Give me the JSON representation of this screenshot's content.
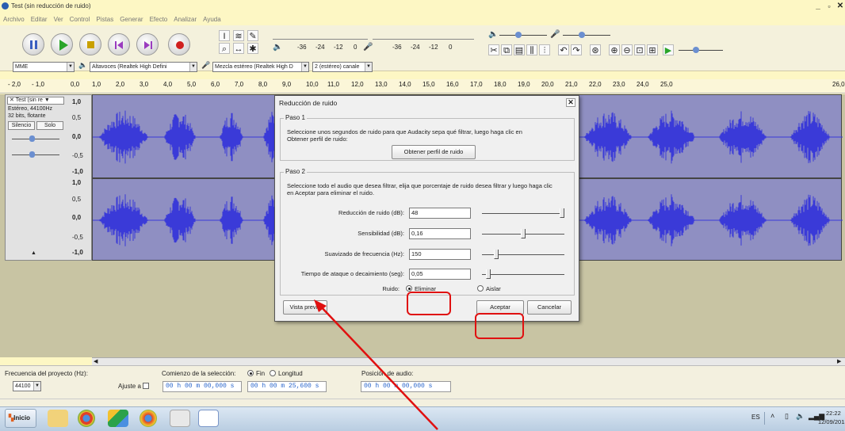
{
  "window": {
    "title": "Test (sin reducción de ruido)"
  },
  "menu": [
    "Archivo",
    "Editar",
    "Ver",
    "Control",
    "Pistas",
    "Generar",
    "Efecto",
    "Analizar",
    "Ayuda"
  ],
  "meters": {
    "play_ticks": [
      "-36",
      "-24",
      "-12",
      "0"
    ],
    "rec_ticks": [
      "-36",
      "-24",
      "-12",
      "0"
    ]
  },
  "devices": {
    "host": "MME",
    "output": "Altavoces (Realtek High Defini",
    "input": "Mezcla estéreo (Realtek High D",
    "channels": "2 (estéreo) canale"
  },
  "ruler": [
    "- 2,0",
    "- 1,0",
    "0,0",
    "1,0",
    "2,0",
    "3,0",
    "4,0",
    "5,0",
    "6,0",
    "7,0",
    "8,0",
    "9,0",
    "10,0",
    "11,0",
    "12,0",
    "13,0",
    "14,0",
    "15,0",
    "16,0",
    "17,0",
    "18,0",
    "19,0",
    "20,0",
    "21,0",
    "22,0",
    "23,0",
    "24,0",
    "25,0",
    "26,0"
  ],
  "track": {
    "name": "Test (sin re",
    "info1": "Estéreo, 44100Hz",
    "info2": "32 bits, flotante",
    "mute": "Silencio",
    "solo": "Solo",
    "scale_top": [
      "1,0",
      "0,5",
      "0,0",
      "-0,5",
      "-1,0"
    ],
    "scale_bottom": [
      "1,0",
      "0,5",
      "0,0",
      "-0,5",
      "-1,0"
    ]
  },
  "dialog": {
    "title": "Reducción de ruido",
    "step1_label": "Paso 1",
    "step1_text": "Seleccione unos segundos de ruido para que Audacity sepa qué filtrar, luego haga clic en Obtener perfil de ruido:",
    "profile_button": "Obtener perfil de ruido",
    "step2_label": "Paso 2",
    "step2_text": "Seleccione todo el audio que desea filtrar, elija que porcentaje de ruido desea filtrar y luego haga clic en Aceptar para eliminar el ruido.",
    "params": [
      {
        "label": "Reducción de ruido (dB):",
        "value": "48",
        "level": 1.0
      },
      {
        "label": "Sensibilidad (dB):",
        "value": "0,16",
        "level": 0.5
      },
      {
        "label": "Suavizado de frecuencia (Hz):",
        "value": "150",
        "level": 0.15
      },
      {
        "label": "Tiempo de ataque o decaimiento (seg):",
        "value": "0,05",
        "level": 0.05
      }
    ],
    "noise_label": "Ruido:",
    "opt_remove": "Eliminar",
    "opt_isolate": "Aislar",
    "preview_button": "Vista previa",
    "ok_button": "Aceptar",
    "cancel_button": "Cancelar"
  },
  "selection_bar": {
    "rate_label": "Frecuencia del proyecto (Hz):",
    "rate_value": "44100",
    "snap_label": "Ajuste a",
    "sel_label": "Comienzo de la selección:",
    "end_label": "Fin",
    "length_label": "Longitud",
    "start_time": "00 h 00 m 00,000 s",
    "end_time": "00 h 00 m 25,600 s",
    "pos_label": "Posición de audio:",
    "pos_time": "00 h 00 m 00,000 s"
  },
  "taskbar": {
    "start": "Inicio",
    "lang": "ES",
    "time": "22:22",
    "date": "12/09/2013"
  },
  "colors": {
    "wave": "#3a3ad8",
    "wave_bg": "#8f8fc2",
    "highlight": "#e01010"
  }
}
